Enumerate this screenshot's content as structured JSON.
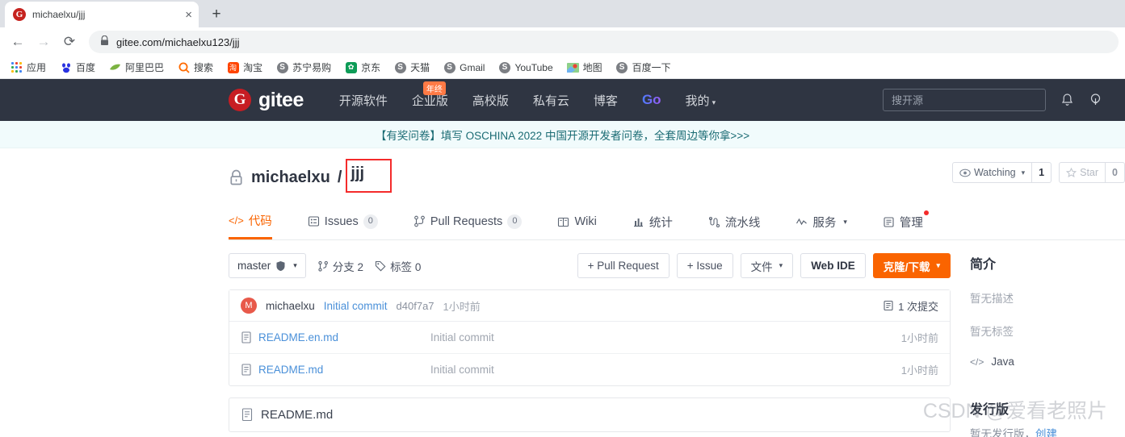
{
  "browser": {
    "tab": {
      "title": "michaelxu/jjj",
      "favicon_letter": "G",
      "close_label": "×"
    },
    "new_tab_label": "+",
    "nav": {
      "back": "←",
      "forward": "→",
      "reload": "⟳"
    },
    "omnibox": {
      "lock_icon": "lock-icon",
      "url": "gitee.com/michaelxu123/jjj"
    },
    "bookmarks": [
      {
        "label": "应用",
        "icon": "apps-grid-icon"
      },
      {
        "label": "百度",
        "icon": "baidu-icon"
      },
      {
        "label": "阿里巴巴",
        "icon": "alibaba-icon"
      },
      {
        "label": "搜索",
        "icon": "search-icon"
      },
      {
        "label": "淘宝",
        "icon": "taobao-icon"
      },
      {
        "label": "苏宁易购",
        "icon": "globe-icon"
      },
      {
        "label": "京东",
        "icon": "jd-icon"
      },
      {
        "label": "天猫",
        "icon": "globe-icon"
      },
      {
        "label": "Gmail",
        "icon": "globe-icon"
      },
      {
        "label": "YouTube",
        "icon": "globe-icon"
      },
      {
        "label": "地图",
        "icon": "map-icon"
      },
      {
        "label": "百度一下",
        "icon": "globe-icon"
      }
    ]
  },
  "site_header": {
    "logo_mark": "G",
    "logo_text": "gitee",
    "nav": [
      {
        "label": "开源软件"
      },
      {
        "label": "企业版",
        "badge": "年终"
      },
      {
        "label": "高校版"
      },
      {
        "label": "私有云"
      },
      {
        "label": "博客"
      },
      {
        "label": "Go",
        "style": "gradient"
      },
      {
        "label": "我的",
        "caret": true
      }
    ],
    "search_placeholder": "搜开源",
    "bell_icon": "bell-icon",
    "bulb_icon": "lightbulb-icon"
  },
  "banner": {
    "text": "【有奖问卷】填写 OSCHINA 2022 中国开源开发者问卷，全套周边等你拿>>>"
  },
  "repo": {
    "visibility_icon": "lock-icon",
    "owner": "michaelxu",
    "separator": "/",
    "name": "jjj",
    "highlight_color": "#f42b2b",
    "watch": {
      "icon": "eye-icon",
      "label": "Watching",
      "count": "1"
    },
    "star": {
      "icon": "star-icon",
      "label": "Star",
      "count": "0"
    },
    "tabs": [
      {
        "label": "代码",
        "icon": "code-icon",
        "active": true
      },
      {
        "label": "Issues",
        "icon": "issue-icon",
        "count": "0"
      },
      {
        "label": "Pull Requests",
        "icon": "pr-icon",
        "count": "0"
      },
      {
        "label": "Wiki",
        "icon": "book-icon"
      },
      {
        "label": "统计",
        "icon": "chart-icon"
      },
      {
        "label": "流水线",
        "icon": "pipeline-icon"
      },
      {
        "label": "服务",
        "icon": "service-icon",
        "caret": true
      },
      {
        "label": "管理",
        "icon": "manage-icon",
        "dot": true
      }
    ]
  },
  "toolbar": {
    "branch": "master",
    "branch_icon": "shield-icon",
    "branches": {
      "icon": "branch-icon",
      "label": "分支 2"
    },
    "tags": {
      "icon": "tag-icon",
      "label": "标签 0"
    },
    "pull_request_label": "+ Pull Request",
    "issue_label": "+ Issue",
    "files_label": "文件",
    "web_ide_label": "Web IDE",
    "clone_label": "克隆/下载",
    "clone_color": "#fa6400"
  },
  "commit": {
    "avatar_letter": "M",
    "author": "michaelxu",
    "message": "Initial commit",
    "sha": "d40f7a7",
    "time": "1小时前",
    "count_icon": "history-icon",
    "count_label": "1 次提交"
  },
  "files": [
    {
      "icon": "file-icon",
      "name": "README.en.md",
      "message": "Initial commit",
      "time": "1小时前"
    },
    {
      "icon": "file-icon",
      "name": "README.md",
      "message": "Initial commit",
      "time": "1小时前"
    }
  ],
  "readme": {
    "icon": "file-icon",
    "title": "README.md"
  },
  "sidebar": {
    "about_title": "简介",
    "no_description": "暂无描述",
    "no_tags": "暂无标签",
    "language": {
      "icon": "code-icon",
      "label": "Java"
    },
    "releases_title": "发行版",
    "releases_empty": "暂无发行版，",
    "releases_create": "创建"
  },
  "watermark": {
    "text": "CSDN @爱看老照片"
  }
}
